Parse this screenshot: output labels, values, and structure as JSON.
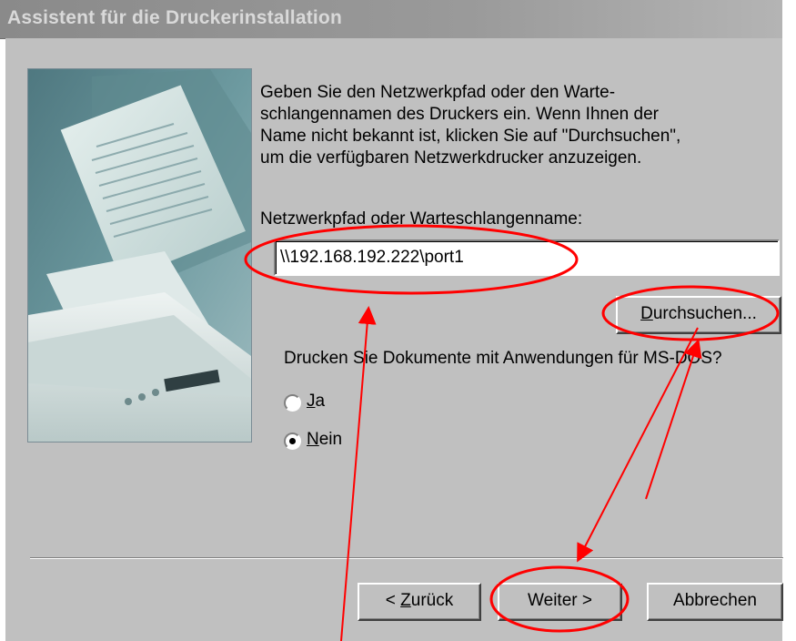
{
  "window": {
    "title": "Assistent für die Druckerinstallation"
  },
  "instructions": {
    "line1": "Geben Sie den Netzwerkpfad oder den Warte-",
    "line2": "schlangennamen des Druckers ein. Wenn Ihnen der",
    "line3": "Name nicht bekannt ist, klicken Sie auf \"Durchsuchen\",",
    "line4": "um die verfügbaren Netzwerkdrucker anzuzeigen."
  },
  "path_field": {
    "label": "Netzwerkpfad oder Warteschlangenname:",
    "value": "\\\\192.168.192.222\\port1"
  },
  "browse_button": {
    "label_ul": "D",
    "label_rest": "urchsuchen..."
  },
  "dos_question": "Drucken Sie Dokumente mit Anwendungen für MS-DOS?",
  "radio_options": {
    "ja": {
      "ul": "J",
      "rest": "a",
      "selected": false
    },
    "nein": {
      "ul": "N",
      "rest": "ein",
      "selected": true
    }
  },
  "nav_buttons": {
    "back_prefix": "< ",
    "back_ul": "Z",
    "back_rest": "urück",
    "next": "Weiter >",
    "cancel": "Abbrechen"
  },
  "annotation": {
    "color": "#ff0000",
    "highlights": [
      "path-field",
      "browse-button",
      "next-button"
    ]
  }
}
